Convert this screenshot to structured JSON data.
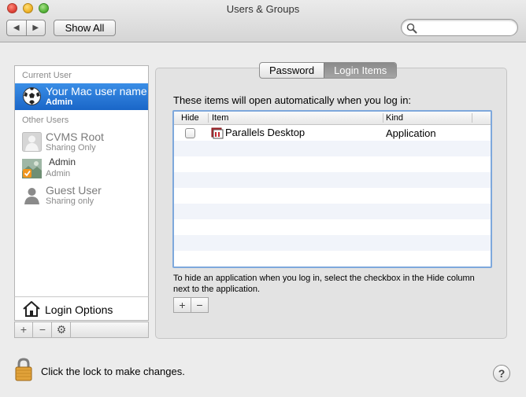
{
  "window": {
    "title": "Users & Groups"
  },
  "toolbar": {
    "back_icon": "chevron-left-icon",
    "forward_icon": "chevron-right-icon",
    "show_all_label": "Show All",
    "search_value": "",
    "search_icon": "magnifier-icon"
  },
  "sidebar": {
    "current_user_heading": "Current User",
    "current_user": {
      "name": "Your Mac user name",
      "role": "Admin",
      "icon": "soccer-ball-avatar"
    },
    "other_users_heading": "Other Users",
    "other_users": [
      {
        "name": "CVMS Root",
        "role": "Sharing Only",
        "icon": "generic-user-silhouette"
      },
      {
        "name": "Admin",
        "role": "Admin",
        "icon": "photo-avatar"
      },
      {
        "name": "Guest User",
        "role": "Sharing only",
        "icon": "guest-user-icon"
      }
    ],
    "login_options_label": "Login Options",
    "buttons": {
      "add": "+",
      "remove": "−",
      "action_icon": "gear-icon"
    }
  },
  "tabs": [
    {
      "label": "Password",
      "active": false
    },
    {
      "label": "Login Items",
      "active": true
    }
  ],
  "login_items": {
    "caption": "These items will open automatically when you log in:",
    "columns": {
      "hide": "Hide",
      "item": "Item",
      "kind": "Kind"
    },
    "rows": [
      {
        "hide": false,
        "item": "Parallels Desktop",
        "kind": "Application",
        "icon": "parallels-icon"
      }
    ],
    "hint": "To hide an application when you log in, select the checkbox in the Hide column next to the application.",
    "add_label": "+",
    "remove_label": "−"
  },
  "footer": {
    "lock_text": "Click the lock to make changes.",
    "lock_icon": "lock-icon",
    "help_label": "?"
  }
}
